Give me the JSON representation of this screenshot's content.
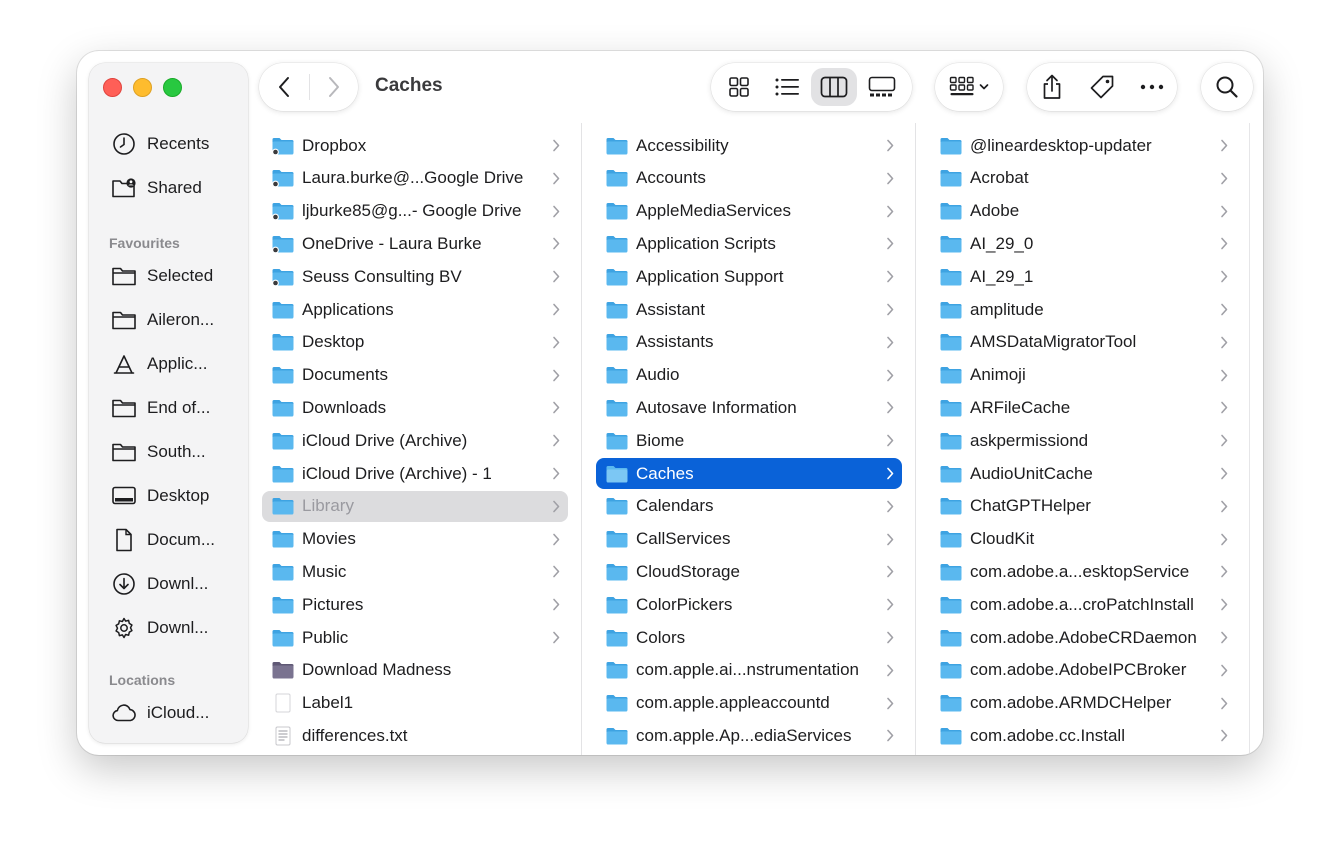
{
  "window": {
    "title": "Caches"
  },
  "sidebar": {
    "top_items": [
      {
        "label": "Recents",
        "icon": "clock-icon"
      },
      {
        "label": "Shared",
        "icon": "shared-folder-icon"
      }
    ],
    "favourites_title": "Favourites",
    "favourites": [
      {
        "label": "Selected",
        "icon": "folder-icon"
      },
      {
        "label": "Aileron...",
        "icon": "folder-icon"
      },
      {
        "label": "Applic...",
        "icon": "applications-icon"
      },
      {
        "label": "End of...",
        "icon": "folder-icon"
      },
      {
        "label": "South...",
        "icon": "folder-icon"
      },
      {
        "label": "Desktop",
        "icon": "desktop-icon"
      },
      {
        "label": "Docum...",
        "icon": "document-icon"
      },
      {
        "label": "Downl...",
        "icon": "download-icon"
      },
      {
        "label": "Downl...",
        "icon": "gear-icon"
      }
    ],
    "locations_title": "Locations",
    "locations": [
      {
        "label": "iCloud...",
        "icon": "cloud-icon"
      }
    ]
  },
  "toolbar": {
    "back_icon": "chevron-left-icon",
    "forward_icon": "chevron-right-icon",
    "view_icons": [
      "grid-view-icon",
      "list-view-icon",
      "column-view-icon",
      "gallery-view-icon"
    ],
    "active_view": "column-view-icon",
    "group_icon": "group-by-icon",
    "share_icon": "share-icon",
    "tag_icon": "tag-icon",
    "more_icon": "ellipsis-icon",
    "search_icon": "search-icon"
  },
  "columns": [
    {
      "items": [
        {
          "label": "Dropbox",
          "kind": "cloud-folder",
          "chevron": true
        },
        {
          "label": "Laura.burke@...Google Drive",
          "kind": "cloud-folder",
          "chevron": true
        },
        {
          "label": "ljburke85@g...- Google Drive",
          "kind": "cloud-folder",
          "chevron": true
        },
        {
          "label": "OneDrive - Laura Burke",
          "kind": "cloud-folder",
          "chevron": true
        },
        {
          "label": "Seuss Consulting BV",
          "kind": "cloud-folder",
          "chevron": true
        },
        {
          "label": "Applications",
          "kind": "folder",
          "chevron": true
        },
        {
          "label": "Desktop",
          "kind": "folder",
          "chevron": true
        },
        {
          "label": "Documents",
          "kind": "folder",
          "chevron": true
        },
        {
          "label": "Downloads",
          "kind": "folder",
          "chevron": true
        },
        {
          "label": "iCloud Drive (Archive)",
          "kind": "folder",
          "chevron": true
        },
        {
          "label": "iCloud Drive (Archive) - 1",
          "kind": "folder",
          "chevron": true
        },
        {
          "label": "Library",
          "kind": "folder",
          "chevron": true,
          "state": "path"
        },
        {
          "label": "Movies",
          "kind": "folder",
          "chevron": true
        },
        {
          "label": "Music",
          "kind": "folder",
          "chevron": true
        },
        {
          "label": "Pictures",
          "kind": "folder",
          "chevron": true
        },
        {
          "label": "Public",
          "kind": "folder",
          "chevron": true
        },
        {
          "label": "Download Madness",
          "kind": "dark-folder",
          "chevron": false
        },
        {
          "label": "Label1",
          "kind": "file",
          "chevron": false
        },
        {
          "label": "differences.txt",
          "kind": "text-file",
          "chevron": false
        }
      ]
    },
    {
      "items": [
        {
          "label": "Accessibility",
          "kind": "folder",
          "chevron": true
        },
        {
          "label": "Accounts",
          "kind": "folder",
          "chevron": true
        },
        {
          "label": "AppleMediaServices",
          "kind": "folder",
          "chevron": true
        },
        {
          "label": "Application Scripts",
          "kind": "folder",
          "chevron": true
        },
        {
          "label": "Application Support",
          "kind": "folder",
          "chevron": true
        },
        {
          "label": "Assistant",
          "kind": "folder",
          "chevron": true
        },
        {
          "label": "Assistants",
          "kind": "folder",
          "chevron": true
        },
        {
          "label": "Audio",
          "kind": "folder",
          "chevron": true
        },
        {
          "label": "Autosave Information",
          "kind": "folder",
          "chevron": true
        },
        {
          "label": "Biome",
          "kind": "folder",
          "chevron": true
        },
        {
          "label": "Caches",
          "kind": "folder",
          "chevron": true,
          "state": "selected"
        },
        {
          "label": "Calendars",
          "kind": "folder",
          "chevron": true
        },
        {
          "label": "CallServices",
          "kind": "folder",
          "chevron": true
        },
        {
          "label": "CloudStorage",
          "kind": "folder",
          "chevron": true
        },
        {
          "label": "ColorPickers",
          "kind": "folder",
          "chevron": true
        },
        {
          "label": "Colors",
          "kind": "folder",
          "chevron": true
        },
        {
          "label": "com.apple.ai...nstrumentation",
          "kind": "folder",
          "chevron": true
        },
        {
          "label": "com.apple.appleaccountd",
          "kind": "folder",
          "chevron": true
        },
        {
          "label": "com.apple.Ap...ediaServices",
          "kind": "folder",
          "chevron": true
        }
      ]
    },
    {
      "items": [
        {
          "label": "@lineardesktop-updater",
          "kind": "folder",
          "chevron": true
        },
        {
          "label": "Acrobat",
          "kind": "folder",
          "chevron": true
        },
        {
          "label": "Adobe",
          "kind": "folder",
          "chevron": true
        },
        {
          "label": "AI_29_0",
          "kind": "folder",
          "chevron": true
        },
        {
          "label": "AI_29_1",
          "kind": "folder",
          "chevron": true
        },
        {
          "label": "amplitude",
          "kind": "folder",
          "chevron": true
        },
        {
          "label": "AMSDataMigratorTool",
          "kind": "folder",
          "chevron": true
        },
        {
          "label": "Animoji",
          "kind": "folder",
          "chevron": true
        },
        {
          "label": "ARFileCache",
          "kind": "folder",
          "chevron": true
        },
        {
          "label": "askpermissiond",
          "kind": "folder",
          "chevron": true
        },
        {
          "label": "AudioUnitCache",
          "kind": "folder",
          "chevron": true
        },
        {
          "label": "ChatGPTHelper",
          "kind": "folder",
          "chevron": true
        },
        {
          "label": "CloudKit",
          "kind": "folder",
          "chevron": true
        },
        {
          "label": "com.adobe.a...esktopService",
          "kind": "folder",
          "chevron": true
        },
        {
          "label": "com.adobe.a...croPatchInstall",
          "kind": "folder",
          "chevron": true
        },
        {
          "label": "com.adobe.AdobeCRDaemon",
          "kind": "folder",
          "chevron": true
        },
        {
          "label": "com.adobe.AdobeIPCBroker",
          "kind": "folder",
          "chevron": true
        },
        {
          "label": "com.adobe.ARMDCHelper",
          "kind": "folder",
          "chevron": true
        },
        {
          "label": "com.adobe.cc.Install",
          "kind": "folder",
          "chevron": true
        }
      ]
    }
  ],
  "colors": {
    "folder_fill": "#5ab8ef",
    "folder_tab": "#3ea3e2",
    "selection": "#0a62d8",
    "path_highlight": "#dcdcde"
  }
}
